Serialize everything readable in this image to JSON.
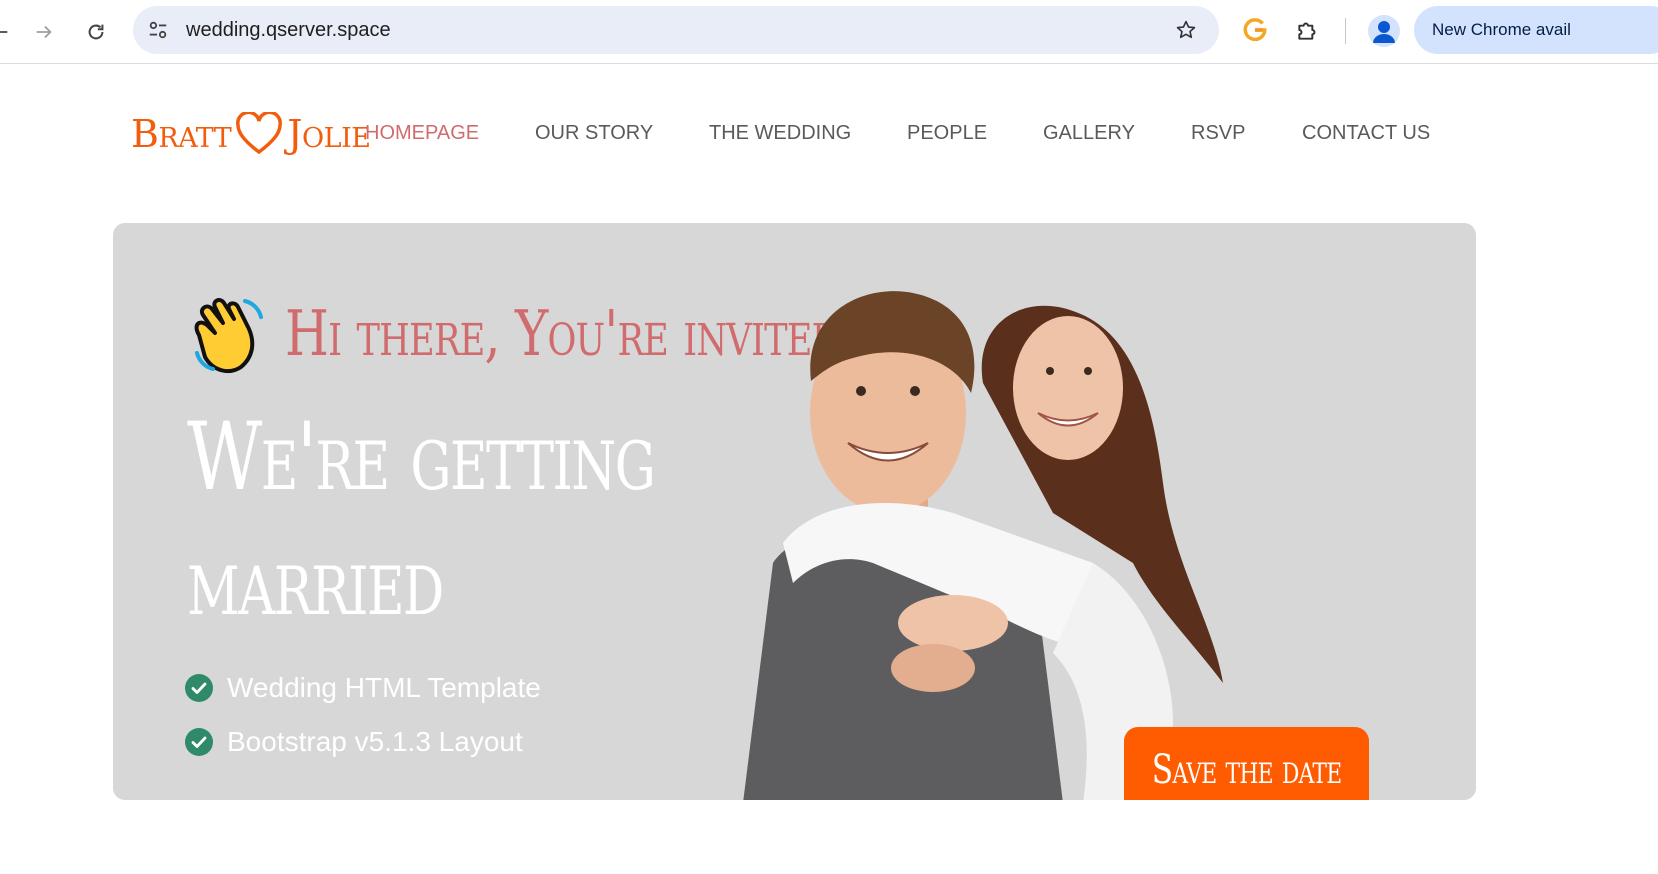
{
  "browser": {
    "url": "wedding.qserver.space",
    "update_button": "New Chrome avail"
  },
  "site": {
    "logo": {
      "left": "Bratt",
      "right": "Jolie"
    },
    "nav": [
      {
        "label": "HOMEPAGE",
        "active": true
      },
      {
        "label": "OUR STORY",
        "active": false
      },
      {
        "label": "THE WEDDING",
        "active": false
      },
      {
        "label": "PEOPLE",
        "active": false
      },
      {
        "label": "GALLERY",
        "active": false
      },
      {
        "label": "RSVP",
        "active": false
      },
      {
        "label": "CONTACT US",
        "active": false
      }
    ]
  },
  "hero": {
    "greeting": "Hi there, You're invited",
    "headline_line1": "We're getting",
    "headline_line2": "married",
    "features": [
      "Wedding HTML Template",
      "Bootstrap v5.1.3 Layout"
    ],
    "cta": "Save the date"
  },
  "colors": {
    "accent_orange": "#ff5b00",
    "logo_orange": "#f25c0d",
    "rose": "#d06b6e",
    "hero_bg": "#d8d7d7",
    "check_green": "#2f8a6a",
    "nav_text": "#5a5a5a"
  }
}
